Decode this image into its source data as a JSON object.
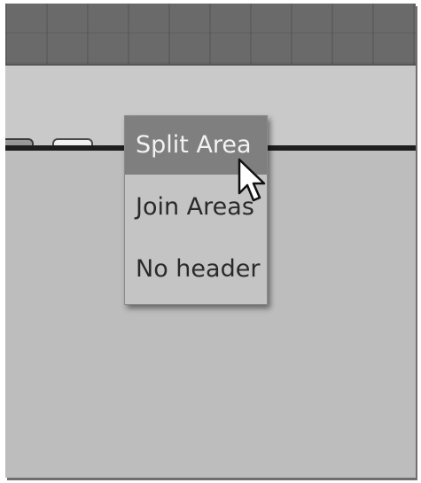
{
  "header": {
    "lock_icon": "lock-icon",
    "image_icon": "image-icon"
  },
  "context_menu": {
    "items": [
      {
        "label": "Split Area",
        "selected": true
      },
      {
        "label": "Join Areas",
        "selected": false
      },
      {
        "label": "No header",
        "selected": false
      }
    ]
  },
  "cursor": {
    "icon": "arrow-cursor-icon"
  },
  "colors": {
    "top_strip": "#6a6a6a",
    "header_bar": "#c9c9c9",
    "area": "#bdbdbd",
    "menu_bg": "#c4c4c4",
    "menu_selected": "#7f7f7f"
  }
}
